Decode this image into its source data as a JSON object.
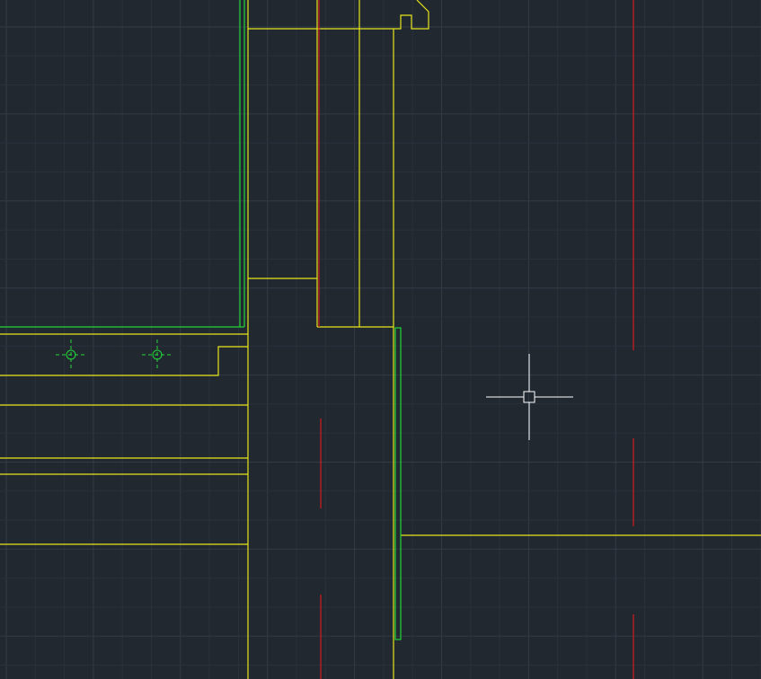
{
  "app": {
    "view": "model-space",
    "background_color": "#212830"
  },
  "colors": {
    "grid_minor": "#2a313c",
    "grid_major": "#333b47",
    "yellow_layer": "#e6e61a",
    "green_layer": "#22d638",
    "red_layer": "#d41c1c",
    "crosshair": "#ffffff",
    "background": "#212830"
  },
  "layers": [
    {
      "name": "walls",
      "color_key": "yellow_layer"
    },
    {
      "name": "structure",
      "color_key": "green_layer"
    },
    {
      "name": "centerlines",
      "color_key": "red_layer"
    }
  ],
  "symbols": [
    {
      "type": "column-marker"
    },
    {
      "type": "column-marker"
    }
  ],
  "cursor": {
    "type": "crosshair-pickbox"
  }
}
